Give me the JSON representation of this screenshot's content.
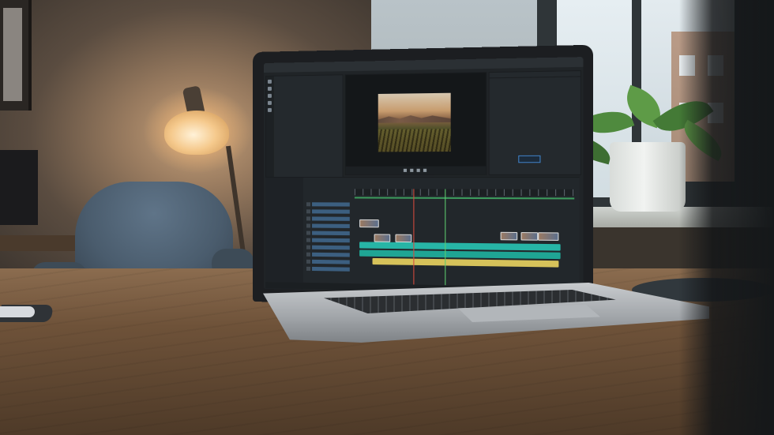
{
  "editor": {
    "tab_active": "",
    "menu_items": [],
    "project_files": [],
    "effects_rows": [],
    "timeline_tools": [],
    "status": []
  },
  "colors": {
    "accent_green": "#6fe08a",
    "clip_teal": "#27b5a6",
    "clip_yellow": "#d6c25a",
    "playhead_red": "#d84a3c",
    "highlight_blue": "#3f7fc4"
  },
  "icons": {
    "play": "play-icon",
    "stop": "stop-icon",
    "step_back": "step-back-icon",
    "step_forward": "step-forward-icon"
  }
}
